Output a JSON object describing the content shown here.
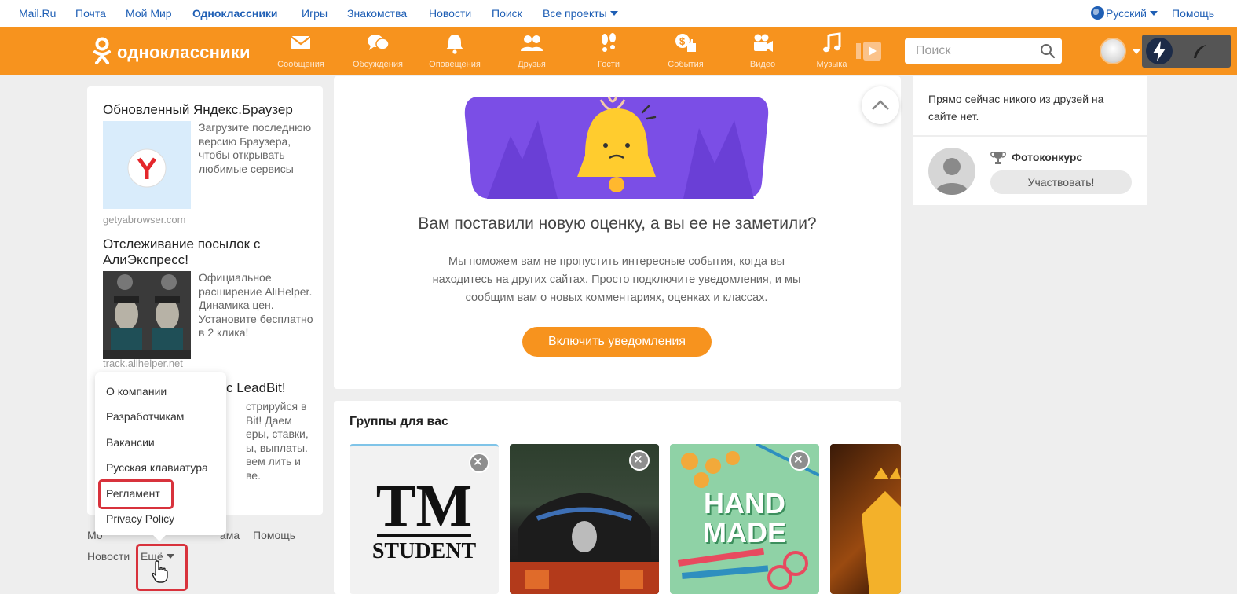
{
  "topbar": {
    "links": [
      "Mail.Ru",
      "Почта",
      "Мой Мир",
      "Одноклассники",
      "Игры",
      "Знакомства",
      "Новости",
      "Поиск"
    ],
    "all_projects": "Все проекты",
    "language": "Русский",
    "help": "Помощь"
  },
  "header": {
    "logo_text": "одноклассники",
    "nav": [
      {
        "label": "Сообщения",
        "icon": "envelope-icon"
      },
      {
        "label": "Обсуждения",
        "icon": "chat-bubbles-icon"
      },
      {
        "label": "Оповещения",
        "icon": "bell-icon"
      },
      {
        "label": "Друзья",
        "icon": "people-icon"
      },
      {
        "label": "Гости",
        "icon": "footprints-icon"
      },
      {
        "label": "События",
        "icon": "like-dollar-icon"
      },
      {
        "label": "Видео",
        "icon": "video-camera-icon"
      },
      {
        "label": "Музыка",
        "icon": "music-note-icon"
      }
    ],
    "search_placeholder": "Поиск"
  },
  "left_ads": [
    {
      "title": "Обновленный Яндекс.Браузер",
      "desc": "Загрузите последнюю версию Браузера, чтобы открывать любимые сервисы",
      "source": "getyabrowser.com"
    },
    {
      "title": "Отслеживание посылок с АлиЭкспресс!",
      "desc": "Официальное расширение AliHelper. Динамика цен. Установите бесплатно в 2 клика!",
      "source": "track.alihelper.net"
    },
    {
      "title_partial": "с LeadBit!",
      "desc_lines": [
        "стрируйся в",
        "Bit! Даем",
        "еры, ставки,",
        "ы, выплаты.",
        "вем лить и",
        "ве."
      ]
    }
  ],
  "dropdown": {
    "items": [
      "О компании",
      "Разработчикам",
      "Вакансии",
      "Русская клавиатура",
      "Регламент",
      "Privacy Policy"
    ],
    "highlighted": "Регламент"
  },
  "left_footer": {
    "row1": [
      "Мо",
      "ама",
      "Помощь"
    ],
    "row2_news": "Новости",
    "more": "Ещё"
  },
  "notification": {
    "title": "Вам поставили новую оценку, а вы ее не заметили?",
    "text": "Мы поможем вам не пропустить интересные события, когда вы находитесь на других сайтах. Просто подключите уведомления, и мы сообщим вам о новых комментариях, оценках и классах.",
    "button": "Включить уведомления"
  },
  "groups": {
    "title": "Группы для вас",
    "cards": [
      {
        "line1": "TM",
        "line2": "STUDENT"
      },
      {
        "line1": "",
        "line2": ""
      },
      {
        "line1": "HAND",
        "line2": "MADE"
      },
      {
        "line1": "",
        "line2": ""
      }
    ]
  },
  "right": {
    "friends_text": "Прямо сейчас никого из друзей на сайте нет.",
    "contest_title": "Фотоконкурс",
    "contest_button": "Участвовать!"
  },
  "colors": {
    "ok_orange": "#f7931e",
    "link_blue": "#1f5fb5",
    "highlight_red": "#d8323c"
  }
}
